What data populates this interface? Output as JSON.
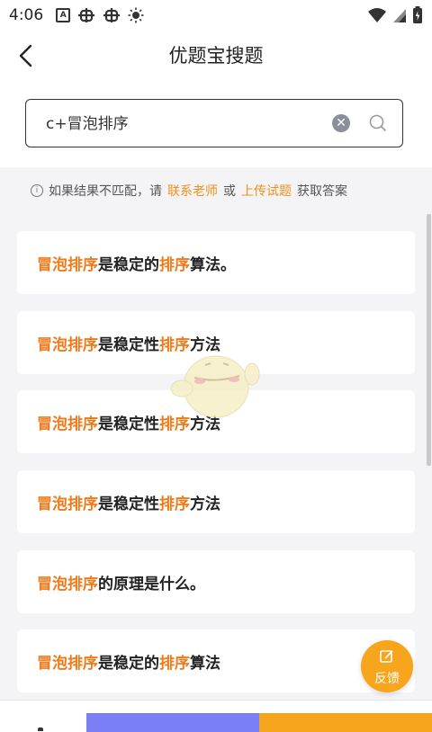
{
  "status_bar": {
    "time": "4:06",
    "icons": [
      "a-icon",
      "bug-icon",
      "bug-icon",
      "brightness-icon",
      "wifi-icon",
      "signal-icon",
      "battery-icon"
    ]
  },
  "header": {
    "title": "优题宝搜题"
  },
  "search": {
    "value": "c+冒泡排序"
  },
  "hint": {
    "prefix": "如果结果不匹配，请",
    "link_teacher": "联系老师",
    "or": "或",
    "link_upload": "上传试题",
    "suffix": "获取答案"
  },
  "results": [
    {
      "parts": [
        {
          "t": "冒泡排序",
          "h": true
        },
        {
          "t": "是稳定的",
          "h": false
        },
        {
          "t": "排序",
          "h": true
        },
        {
          "t": "算法。",
          "h": false
        }
      ]
    },
    {
      "parts": [
        {
          "t": "冒泡排序",
          "h": true
        },
        {
          "t": "是稳定性",
          "h": false
        },
        {
          "t": "排序",
          "h": true
        },
        {
          "t": "方法",
          "h": false
        }
      ]
    },
    {
      "parts": [
        {
          "t": "冒泡排序",
          "h": true
        },
        {
          "t": "是稳定性",
          "h": false
        },
        {
          "t": "排序",
          "h": true
        },
        {
          "t": "方法",
          "h": false
        }
      ]
    },
    {
      "parts": [
        {
          "t": "冒泡排序",
          "h": true
        },
        {
          "t": "是稳定性",
          "h": false
        },
        {
          "t": "排序",
          "h": true
        },
        {
          "t": "方法",
          "h": false
        }
      ]
    },
    {
      "parts": [
        {
          "t": "冒泡排序",
          "h": true
        },
        {
          "t": "的原理是什么。",
          "h": false
        }
      ]
    },
    {
      "parts": [
        {
          "t": "冒泡排序",
          "h": true
        },
        {
          "t": "是稳定的",
          "h": false
        },
        {
          "t": "排序",
          "h": true
        },
        {
          "t": "算法",
          "h": false
        }
      ]
    }
  ],
  "feedback": {
    "label": "反馈"
  },
  "colors": {
    "highlight": "#f07a1a",
    "link": "#f0901a",
    "feedback_bg": "#f7a51c",
    "purple_tab": "#7b7ff5"
  }
}
